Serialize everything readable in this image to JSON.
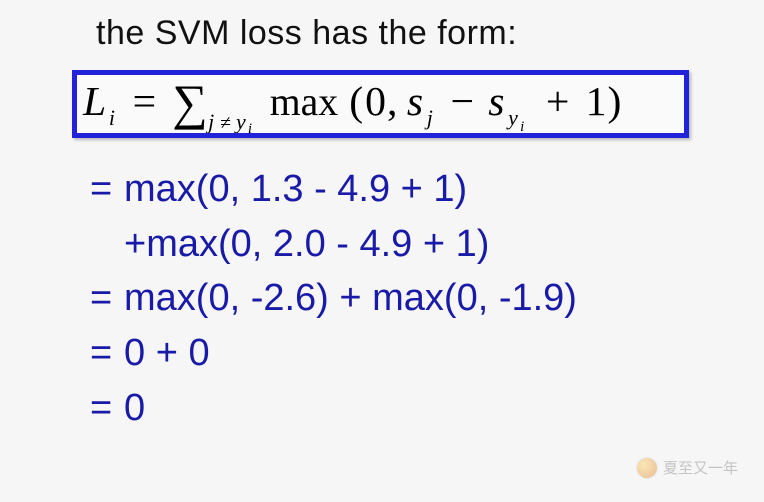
{
  "heading": "the SVM loss has the form:",
  "formula": {
    "lhs_L": "L",
    "lhs_i": "i",
    "eq": "=",
    "sigma": "∑",
    "sub_left": "j",
    "sub_ne": "≠",
    "sub_y": "y",
    "sub_i": "i",
    "fn": "max",
    "open": "(",
    "zero": "0",
    "comma": ",",
    "s1": "s",
    "s1_sub": "j",
    "minus": "−",
    "s2": "s",
    "s2_sub_y": "y",
    "s2_sub_i": "i",
    "plus": "+",
    "one": "1",
    "close": ")"
  },
  "calc": {
    "line1_eq": "=",
    "line1_text": "max(0, 1.3 - 4.9 + 1)",
    "line2_text": "+max(0, 2.0 - 4.9 + 1)",
    "line3_eq": "=",
    "line3_text": "max(0, -2.6) + max(0, -1.9)",
    "line4_eq": "=",
    "line4_text": "0 + 0",
    "line5_eq": "=",
    "line5_text": "0"
  },
  "watermark": {
    "text": "夏至又一年"
  }
}
